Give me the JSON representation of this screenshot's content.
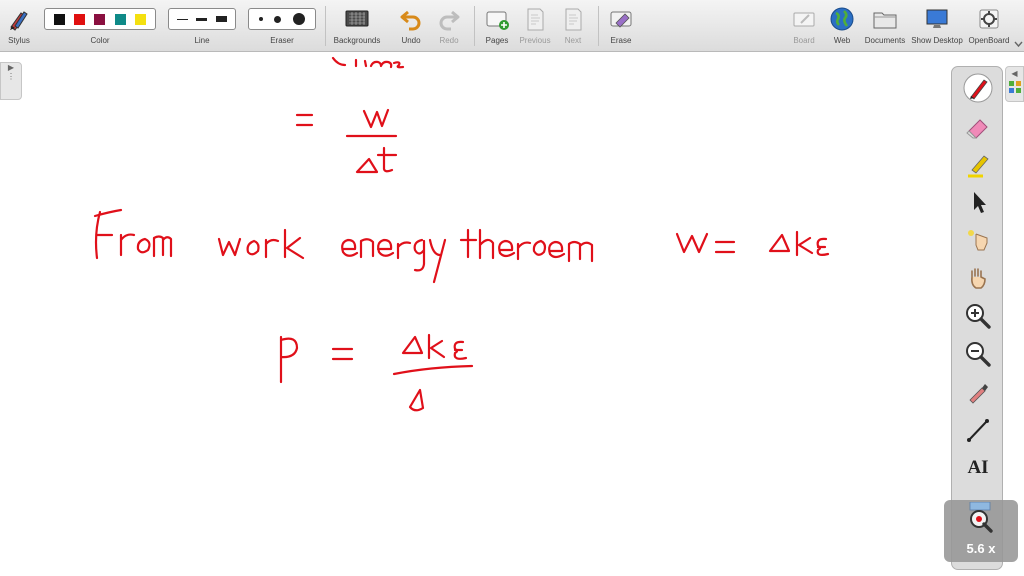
{
  "toolbar": {
    "stylus": "Stylus",
    "color": "Color",
    "line": "Line",
    "eraser": "Eraser",
    "backgrounds": "Backgrounds",
    "undo": "Undo",
    "redo": "Redo",
    "pages": "Pages",
    "previous": "Previous",
    "next": "Next",
    "erase": "Erase",
    "board": "Board",
    "web": "Web",
    "documents": "Documents",
    "show_desktop": "Show Desktop",
    "openboard": "OpenBoard"
  },
  "palette_colors": [
    "#111111",
    "#e01010",
    "#8a1040",
    "#0f8a88",
    "#f4e010"
  ],
  "ink_color": "#e0101a",
  "dock": {
    "tools": [
      "pen-icon",
      "eraser-icon",
      "highlighter-icon",
      "pointer-icon",
      "laser-pointer-icon",
      "hand-icon",
      "zoom-in-icon",
      "zoom-out-icon",
      "color-picker-icon",
      "line-tool-icon",
      "text-tool-icon",
      "magnifier-icon"
    ],
    "text_tool_label": "AI"
  },
  "zoom": {
    "level": "5.6 x"
  }
}
